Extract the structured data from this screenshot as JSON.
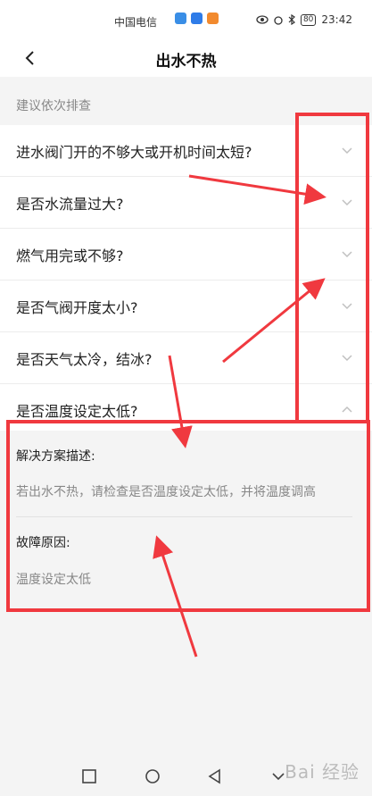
{
  "status_bar": {
    "carrier": "中国电信",
    "time": "23:42",
    "battery": "80"
  },
  "header": {
    "title": "出水不热"
  },
  "section_label": "建议依次排查",
  "faq": [
    {
      "question": "进水阀门开的不够大或开机时间太短?",
      "expanded": false
    },
    {
      "question": "是否水流量过大?",
      "expanded": false
    },
    {
      "question": "燃气用完或不够?",
      "expanded": false
    },
    {
      "question": "是否气阀开度太小?",
      "expanded": false
    },
    {
      "question": "是否天气太冷，结冰?",
      "expanded": false
    },
    {
      "question": "是否温度设定太低?",
      "expanded": true
    }
  ],
  "detail": {
    "solution_label": "解决方案描述:",
    "solution_text": "若出水不热，请检查是否温度设定太低，并将温度调高",
    "cause_label": "故障原因:",
    "cause_text": "温度设定太低"
  },
  "watermark": "Bai 经验",
  "colors": {
    "annotation": "#f0393f",
    "background": "#f4f4f4",
    "muted_text": "#888888"
  }
}
